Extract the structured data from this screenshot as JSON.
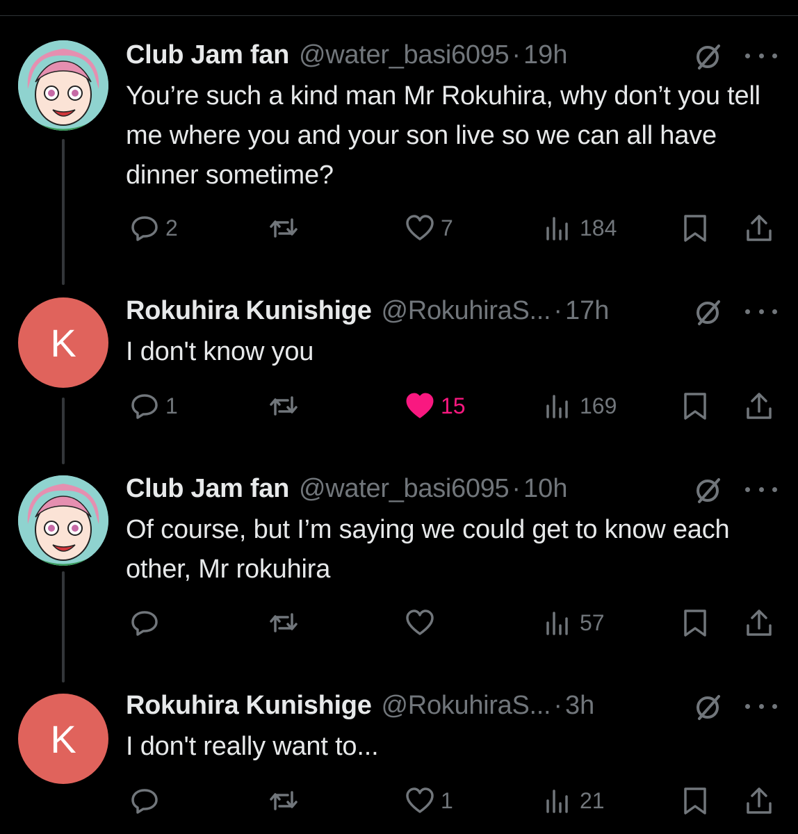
{
  "colors": {
    "background": "#000000",
    "text": "#e7e9ea",
    "muted": "#71767b",
    "like": "#f91880",
    "avatar_k": "#e0635c"
  },
  "tweets": [
    {
      "name": "Club Jam fan",
      "handle": "@water_basi6095",
      "separator": "·",
      "time": "19h",
      "avatar": "anime-avatar",
      "text": "You’re such a kind man Mr Rokuhira, why don’t you tell me where you and your son live so we can all have dinner sometime?",
      "replies": "2",
      "reposts": "",
      "likes": "7",
      "liked": false,
      "views": "184"
    },
    {
      "name": "Rokuhira Kunishige",
      "handle": "@RokuhiraS...",
      "separator": "·",
      "time": "17h",
      "avatar": "K",
      "text": "I don't know you",
      "replies": "1",
      "reposts": "",
      "likes": "15",
      "liked": true,
      "views": "169"
    },
    {
      "name": "Club Jam fan",
      "handle": "@water_basi6095",
      "separator": "·",
      "time": "10h",
      "avatar": "anime-avatar",
      "text": "Of course, but I’m saying we could get to know each other, Mr rokuhira",
      "replies": "",
      "reposts": "",
      "likes": "",
      "liked": false,
      "views": "57"
    },
    {
      "name": "Rokuhira Kunishige",
      "handle": "@RokuhiraS...",
      "separator": "·",
      "time": "3h",
      "avatar": "K",
      "text": "I don't really want to...",
      "replies": "",
      "reposts": "",
      "likes": "1",
      "liked": false,
      "views": "21"
    }
  ]
}
